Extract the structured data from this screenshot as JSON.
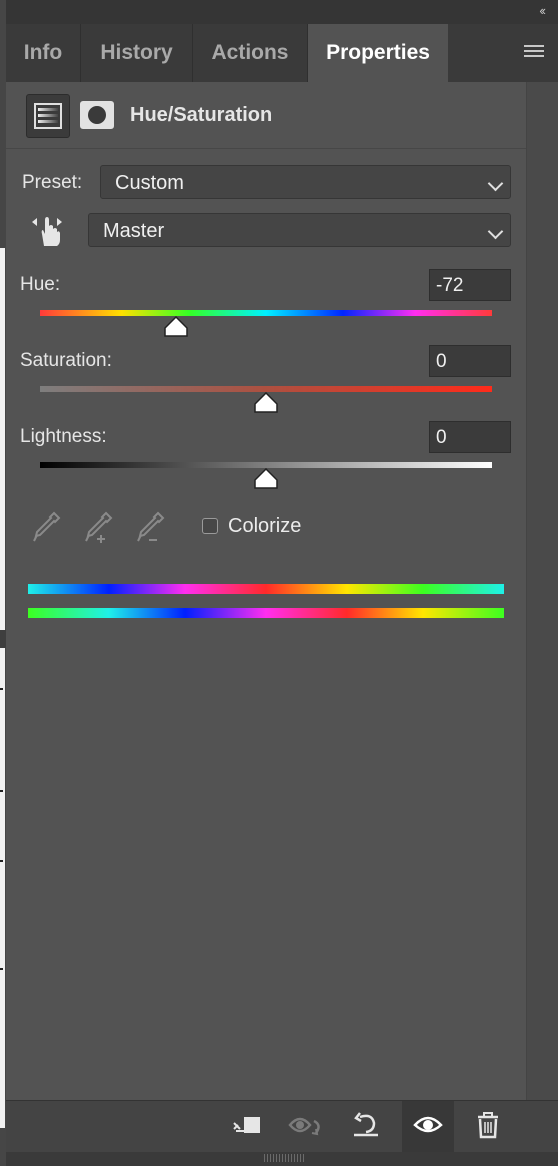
{
  "window": {
    "collapse_glyph": "‹‹"
  },
  "tabs": [
    {
      "label": "Info"
    },
    {
      "label": "History"
    },
    {
      "label": "Actions"
    },
    {
      "label": "Properties",
      "active": true
    }
  ],
  "panel": {
    "title": "Hue/Saturation",
    "preset": {
      "label": "Preset:",
      "value": "Custom"
    },
    "channel": {
      "value": "Master"
    },
    "hue": {
      "label": "Hue:",
      "value": "-72",
      "level": -72,
      "range": [
        -180,
        180
      ]
    },
    "saturation": {
      "label": "Saturation:",
      "value": "0",
      "level": 0,
      "range": [
        -100,
        100
      ]
    },
    "lightness": {
      "label": "Lightness:",
      "value": "0",
      "level": 0,
      "range": [
        -100,
        100
      ]
    },
    "colorize": {
      "label": "Colorize",
      "checked": false
    }
  },
  "icons": {
    "header": [
      "hue-saturation-adjustment-icon",
      "layer-mask-icon"
    ],
    "tools": [
      "eyedropper-icon",
      "eyedropper-add-icon",
      "eyedropper-subtract-icon",
      "on-image-adjust-hand-icon"
    ],
    "bottom": [
      "clip-to-layer-icon",
      "view-previous-state-icon",
      "reset-icon",
      "visibility-eye-icon",
      "trash-icon"
    ]
  },
  "colors": {
    "panel_bg": "#535353",
    "tab_bg": "#3a3a3a",
    "active_tab_bg": "#535353",
    "text": "#e6e6e6"
  }
}
